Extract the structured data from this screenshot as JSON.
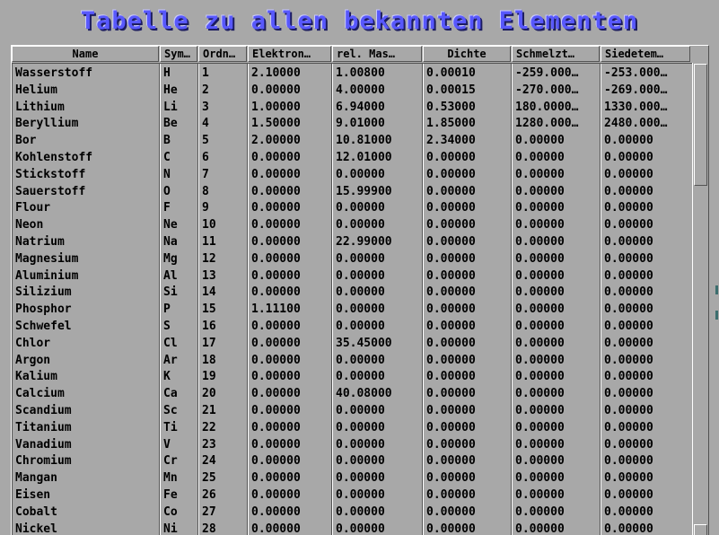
{
  "title": "Tabelle zu allen bekannten Elementen",
  "columns": [
    "Name",
    "Sym…",
    "Ordn…",
    "Elektron…",
    "rel. Mas…",
    "Dichte",
    "Schmelzt…",
    "Siedetem…"
  ],
  "rows": [
    [
      "Wasserstoff",
      "H",
      "1",
      "2.10000",
      "1.00800",
      "0.00010",
      "-259.000…",
      "-253.000…"
    ],
    [
      "Helium",
      "He",
      "2",
      "0.00000",
      "4.00000",
      "0.00015",
      "-270.000…",
      "-269.000…"
    ],
    [
      "Lithium",
      "Li",
      "3",
      "1.00000",
      "6.94000",
      "0.53000",
      "180.0000…",
      "1330.000…"
    ],
    [
      "Beryllium",
      "Be",
      "4",
      "1.50000",
      "9.01000",
      "1.85000",
      "1280.000…",
      "2480.000…"
    ],
    [
      "Bor",
      "B",
      "5",
      "2.00000",
      "10.81000",
      "2.34000",
      "0.00000",
      "0.00000"
    ],
    [
      "Kohlenstoff",
      "C",
      "6",
      "0.00000",
      "12.01000",
      "0.00000",
      "0.00000",
      "0.00000"
    ],
    [
      "Stickstoff",
      "N",
      "7",
      "0.00000",
      "0.00000",
      "0.00000",
      "0.00000",
      "0.00000"
    ],
    [
      "Sauerstoff",
      "O",
      "8",
      "0.00000",
      "15.99900",
      "0.00000",
      "0.00000",
      "0.00000"
    ],
    [
      "Flour",
      "F",
      "9",
      "0.00000",
      "0.00000",
      "0.00000",
      "0.00000",
      "0.00000"
    ],
    [
      "Neon",
      "Ne",
      "10",
      "0.00000",
      "0.00000",
      "0.00000",
      "0.00000",
      "0.00000"
    ],
    [
      "Natrium",
      "Na",
      "11",
      "0.00000",
      "22.99000",
      "0.00000",
      "0.00000",
      "0.00000"
    ],
    [
      "Magnesium",
      "Mg",
      "12",
      "0.00000",
      "0.00000",
      "0.00000",
      "0.00000",
      "0.00000"
    ],
    [
      "Aluminium",
      "Al",
      "13",
      "0.00000",
      "0.00000",
      "0.00000",
      "0.00000",
      "0.00000"
    ],
    [
      "Silizium",
      "Si",
      "14",
      "0.00000",
      "0.00000",
      "0.00000",
      "0.00000",
      "0.00000"
    ],
    [
      "Phosphor",
      "P",
      "15",
      "1.11100",
      "0.00000",
      "0.00000",
      "0.00000",
      "0.00000"
    ],
    [
      "Schwefel",
      "S",
      "16",
      "0.00000",
      "0.00000",
      "0.00000",
      "0.00000",
      "0.00000"
    ],
    [
      "Chlor",
      "Cl",
      "17",
      "0.00000",
      "35.45000",
      "0.00000",
      "0.00000",
      "0.00000"
    ],
    [
      "Argon",
      "Ar",
      "18",
      "0.00000",
      "0.00000",
      "0.00000",
      "0.00000",
      "0.00000"
    ],
    [
      "Kalium",
      "K",
      "19",
      "0.00000",
      "0.00000",
      "0.00000",
      "0.00000",
      "0.00000"
    ],
    [
      "Calcium",
      "Ca",
      "20",
      "0.00000",
      "40.08000",
      "0.00000",
      "0.00000",
      "0.00000"
    ],
    [
      "Scandium",
      "Sc",
      "21",
      "0.00000",
      "0.00000",
      "0.00000",
      "0.00000",
      "0.00000"
    ],
    [
      "Titanium",
      "Ti",
      "22",
      "0.00000",
      "0.00000",
      "0.00000",
      "0.00000",
      "0.00000"
    ],
    [
      "Vanadium",
      "V",
      "23",
      "0.00000",
      "0.00000",
      "0.00000",
      "0.00000",
      "0.00000"
    ],
    [
      "Chromium",
      "Cr",
      "24",
      "0.00000",
      "0.00000",
      "0.00000",
      "0.00000",
      "0.00000"
    ],
    [
      "Mangan",
      "Mn",
      "25",
      "0.00000",
      "0.00000",
      "0.00000",
      "0.00000",
      "0.00000"
    ],
    [
      "Eisen",
      "Fe",
      "26",
      "0.00000",
      "0.00000",
      "0.00000",
      "0.00000",
      "0.00000"
    ],
    [
      "Cobalt",
      "Co",
      "27",
      "0.00000",
      "0.00000",
      "0.00000",
      "0.00000",
      "0.00000"
    ],
    [
      "Nickel",
      "Ni",
      "28",
      "0.00000",
      "0.00000",
      "0.00000",
      "0.00000",
      "0.00000"
    ]
  ],
  "colors": {
    "background": "#a8a8a8",
    "title": "#5858fc",
    "text": "#000000"
  }
}
